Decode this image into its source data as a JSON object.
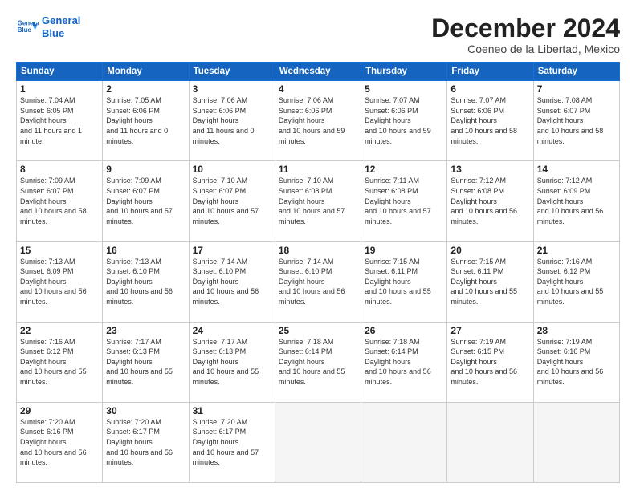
{
  "logo": {
    "line1": "General",
    "line2": "Blue"
  },
  "title": "December 2024",
  "subtitle": "Coeneo de la Libertad, Mexico",
  "days_header": [
    "Sunday",
    "Monday",
    "Tuesday",
    "Wednesday",
    "Thursday",
    "Friday",
    "Saturday"
  ],
  "weeks": [
    [
      {
        "day": "1",
        "rise": "7:04 AM",
        "set": "6:05 PM",
        "daylight": "11 hours and 1 minute."
      },
      {
        "day": "2",
        "rise": "7:05 AM",
        "set": "6:06 PM",
        "daylight": "11 hours and 0 minutes."
      },
      {
        "day": "3",
        "rise": "7:06 AM",
        "set": "6:06 PM",
        "daylight": "11 hours and 0 minutes."
      },
      {
        "day": "4",
        "rise": "7:06 AM",
        "set": "6:06 PM",
        "daylight": "10 hours and 59 minutes."
      },
      {
        "day": "5",
        "rise": "7:07 AM",
        "set": "6:06 PM",
        "daylight": "10 hours and 59 minutes."
      },
      {
        "day": "6",
        "rise": "7:07 AM",
        "set": "6:06 PM",
        "daylight": "10 hours and 58 minutes."
      },
      {
        "day": "7",
        "rise": "7:08 AM",
        "set": "6:07 PM",
        "daylight": "10 hours and 58 minutes."
      }
    ],
    [
      {
        "day": "8",
        "rise": "7:09 AM",
        "set": "6:07 PM",
        "daylight": "10 hours and 58 minutes."
      },
      {
        "day": "9",
        "rise": "7:09 AM",
        "set": "6:07 PM",
        "daylight": "10 hours and 57 minutes."
      },
      {
        "day": "10",
        "rise": "7:10 AM",
        "set": "6:07 PM",
        "daylight": "10 hours and 57 minutes."
      },
      {
        "day": "11",
        "rise": "7:10 AM",
        "set": "6:08 PM",
        "daylight": "10 hours and 57 minutes."
      },
      {
        "day": "12",
        "rise": "7:11 AM",
        "set": "6:08 PM",
        "daylight": "10 hours and 57 minutes."
      },
      {
        "day": "13",
        "rise": "7:12 AM",
        "set": "6:08 PM",
        "daylight": "10 hours and 56 minutes."
      },
      {
        "day": "14",
        "rise": "7:12 AM",
        "set": "6:09 PM",
        "daylight": "10 hours and 56 minutes."
      }
    ],
    [
      {
        "day": "15",
        "rise": "7:13 AM",
        "set": "6:09 PM",
        "daylight": "10 hours and 56 minutes."
      },
      {
        "day": "16",
        "rise": "7:13 AM",
        "set": "6:10 PM",
        "daylight": "10 hours and 56 minutes."
      },
      {
        "day": "17",
        "rise": "7:14 AM",
        "set": "6:10 PM",
        "daylight": "10 hours and 56 minutes."
      },
      {
        "day": "18",
        "rise": "7:14 AM",
        "set": "6:10 PM",
        "daylight": "10 hours and 56 minutes."
      },
      {
        "day": "19",
        "rise": "7:15 AM",
        "set": "6:11 PM",
        "daylight": "10 hours and 55 minutes."
      },
      {
        "day": "20",
        "rise": "7:15 AM",
        "set": "6:11 PM",
        "daylight": "10 hours and 55 minutes."
      },
      {
        "day": "21",
        "rise": "7:16 AM",
        "set": "6:12 PM",
        "daylight": "10 hours and 55 minutes."
      }
    ],
    [
      {
        "day": "22",
        "rise": "7:16 AM",
        "set": "6:12 PM",
        "daylight": "10 hours and 55 minutes."
      },
      {
        "day": "23",
        "rise": "7:17 AM",
        "set": "6:13 PM",
        "daylight": "10 hours and 55 minutes."
      },
      {
        "day": "24",
        "rise": "7:17 AM",
        "set": "6:13 PM",
        "daylight": "10 hours and 55 minutes."
      },
      {
        "day": "25",
        "rise": "7:18 AM",
        "set": "6:14 PM",
        "daylight": "10 hours and 55 minutes."
      },
      {
        "day": "26",
        "rise": "7:18 AM",
        "set": "6:14 PM",
        "daylight": "10 hours and 56 minutes."
      },
      {
        "day": "27",
        "rise": "7:19 AM",
        "set": "6:15 PM",
        "daylight": "10 hours and 56 minutes."
      },
      {
        "day": "28",
        "rise": "7:19 AM",
        "set": "6:16 PM",
        "daylight": "10 hours and 56 minutes."
      }
    ],
    [
      {
        "day": "29",
        "rise": "7:20 AM",
        "set": "6:16 PM",
        "daylight": "10 hours and 56 minutes."
      },
      {
        "day": "30",
        "rise": "7:20 AM",
        "set": "6:17 PM",
        "daylight": "10 hours and 56 minutes."
      },
      {
        "day": "31",
        "rise": "7:20 AM",
        "set": "6:17 PM",
        "daylight": "10 hours and 57 minutes."
      },
      null,
      null,
      null,
      null
    ]
  ]
}
